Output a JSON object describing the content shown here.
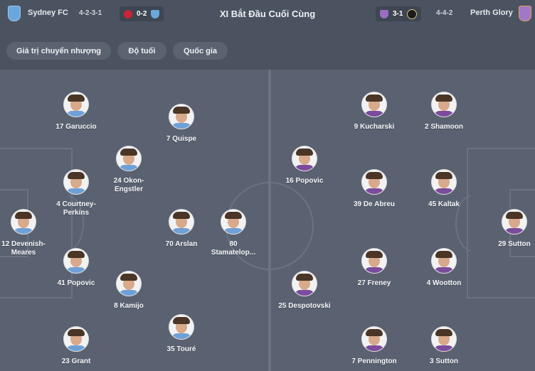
{
  "header": {
    "home_team": "Sydney FC",
    "home_formation": "4-2-3-1",
    "home_score": "0-2",
    "title": "XI Bắt Đầu Cuối Cùng",
    "away_score": "3-1",
    "away_formation": "4-4-2",
    "away_team": "Perth Glory"
  },
  "filters": [
    "Giá trị chuyển nhượng",
    "Độ tuổi",
    "Quốc gia"
  ],
  "home_players": [
    {
      "label": "17 Garuccio"
    },
    {
      "label": "7 Quispe"
    },
    {
      "label": "24 Okon-\nEngstler"
    },
    {
      "label": "4 Courtney-\nPerkins"
    },
    {
      "label": "12 Devenish-\nMeares"
    },
    {
      "label": "70 Arslan"
    },
    {
      "label": "80\nStamatelop..."
    },
    {
      "label": "41 Popovic"
    },
    {
      "label": "8 Kamijo"
    },
    {
      "label": "35 Touré"
    },
    {
      "label": "23 Grant"
    }
  ],
  "away_players": [
    {
      "label": "9 Kucharski"
    },
    {
      "label": "2 Shamoon"
    },
    {
      "label": "16 Popovic"
    },
    {
      "label": "39 De Abreu"
    },
    {
      "label": "45 Kaltak"
    },
    {
      "label": "29 Sutton"
    },
    {
      "label": "27 Freney"
    },
    {
      "label": "4 Wootton"
    },
    {
      "label": "25 Despotovski"
    },
    {
      "label": "7 Pennington"
    },
    {
      "label": "3 Sutton"
    }
  ],
  "colors": {
    "home_shirt": "#6fa0d8",
    "away_shirt": "#7b4b9c"
  }
}
